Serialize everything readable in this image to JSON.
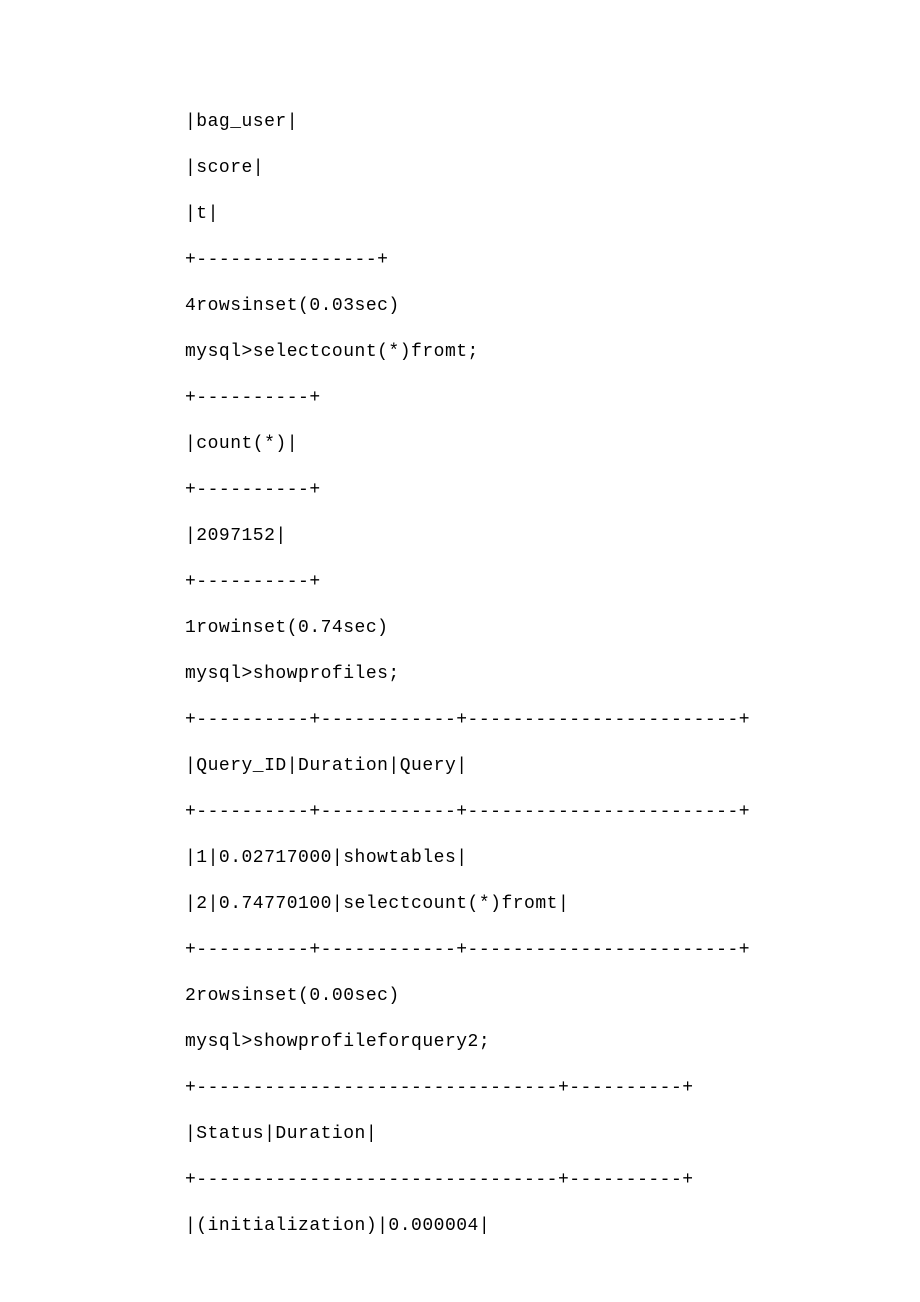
{
  "lines": [
    "|bag_user|",
    "|score|",
    "|t|",
    "+----------------+",
    "4rowsinset(0.03sec)",
    "mysql>selectcount(*)fromt;",
    "+----------+",
    "|count(*)|",
    "+----------+",
    "|2097152|",
    "+----------+",
    "1rowinset(0.74sec)",
    "mysql>showprofiles;",
    "+----------+------------+------------------------+",
    "|Query_ID|Duration|Query|",
    "+----------+------------+------------------------+",
    "|1|0.02717000|showtables|",
    "|2|0.74770100|selectcount(*)fromt|",
    "+----------+------------+------------------------+",
    "2rowsinset(0.00sec)",
    "mysql>showprofileforquery2;",
    "+--------------------------------+----------+",
    "|Status|Duration|",
    "+--------------------------------+----------+",
    "|(initialization)|0.000004|"
  ]
}
